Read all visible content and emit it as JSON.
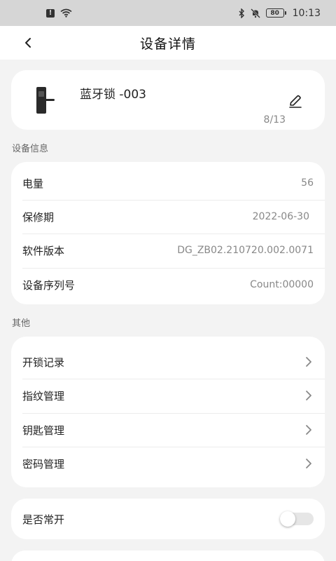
{
  "status_bar": {
    "alert_icon": "alert-icon",
    "wifi_icon": "wifi-icon",
    "bluetooth_icon": "bluetooth-icon",
    "mute_icon": "mute-icon",
    "battery_level": "80",
    "time": "10:13"
  },
  "header": {
    "title": "设备详情",
    "back_icon": "back-chevron-icon"
  },
  "device": {
    "name": "蓝牙锁 -003",
    "name_count": "8/13",
    "edit_icon": "pencil-icon"
  },
  "info_section": {
    "label": "设备信息",
    "rows": [
      {
        "label": "电量",
        "value": "56"
      },
      {
        "label": "保修期",
        "value": "2022-06-30"
      },
      {
        "label": "软件版本",
        "value": "DG_ZB02.210720.002.0071"
      },
      {
        "label": "设备序列号",
        "value": "Count:00000"
      }
    ]
  },
  "other_section": {
    "label": "其他",
    "items": [
      {
        "label": "开锁记录"
      },
      {
        "label": "指纹管理"
      },
      {
        "label": "钥匙管理"
      },
      {
        "label": "密码管理"
      }
    ]
  },
  "always_open": {
    "label": "是否常开",
    "enabled": false
  },
  "colors": {
    "background": "#f3f3f3",
    "card": "#ffffff",
    "status_bar": "#d6d6d6",
    "muted_text": "#888888"
  }
}
